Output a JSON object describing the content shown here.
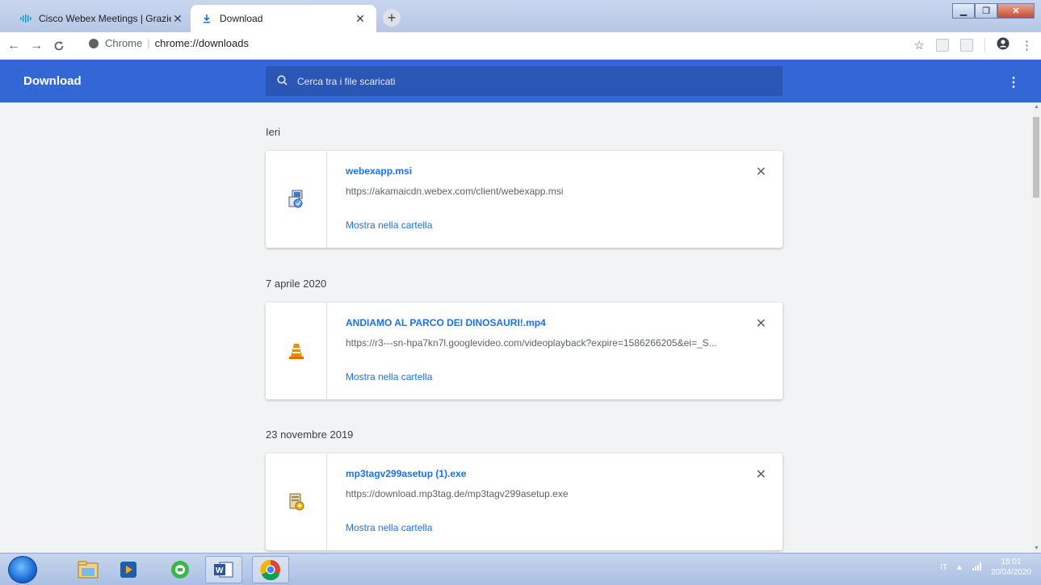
{
  "tabs": [
    {
      "title": "Cisco Webex Meetings | Grazie",
      "favicon": "cisco-icon",
      "active": false
    },
    {
      "title": "Download",
      "favicon": "download-icon",
      "active": true
    }
  ],
  "omnibox": {
    "scheme_label": "Chrome",
    "url": "chrome://downloads"
  },
  "header": {
    "title": "Download",
    "search_placeholder": "Cerca tra i file scaricati"
  },
  "groups": [
    {
      "date": "Ieri",
      "items": [
        {
          "filename": "webexapp.msi",
          "url": "https://akamaicdn.webex.com/client/webexapp.msi",
          "action": "Mostra nella cartella",
          "icon": "msi-installer-icon"
        }
      ]
    },
    {
      "date": "7 aprile 2020",
      "items": [
        {
          "filename": "ANDIAMO AL PARCO DEI DINOSAURI!.mp4",
          "url": "https://r3---sn-hpa7kn7l.googlevideo.com/videoplayback?expire=1586266205&ei=_S...",
          "action": "Mostra nella cartella",
          "icon": "vlc-cone-icon"
        }
      ]
    },
    {
      "date": "23 novembre 2019",
      "items": [
        {
          "filename": "mp3tagv299asetup (1).exe",
          "url": "https://download.mp3tag.de/mp3tagv299asetup.exe",
          "action": "Mostra nella cartella",
          "icon": "exe-setup-icon"
        }
      ]
    }
  ],
  "taskbar": {
    "language": "IT",
    "time": "15:01",
    "date": "20/04/2020"
  }
}
